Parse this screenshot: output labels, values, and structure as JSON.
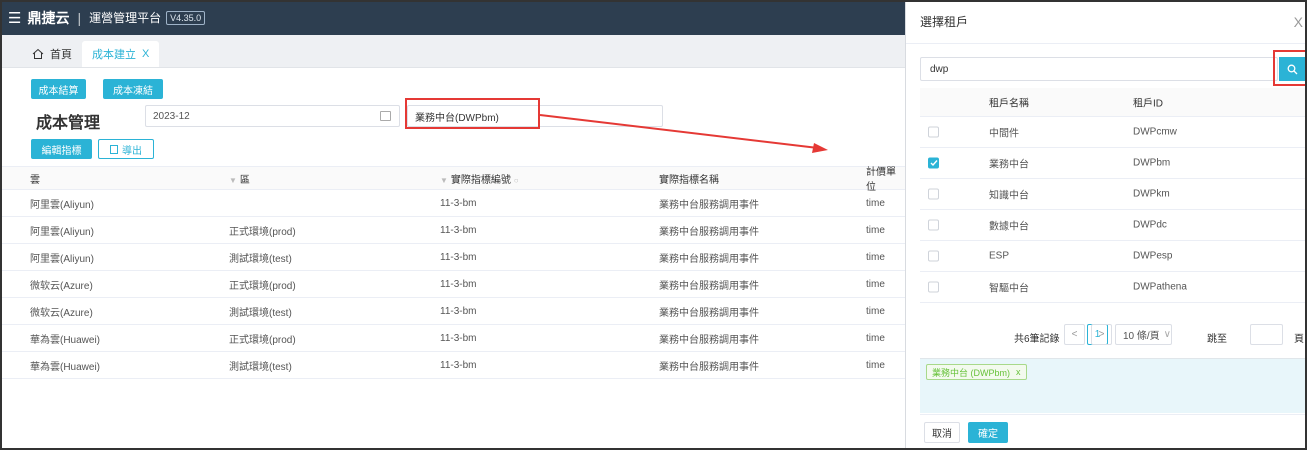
{
  "topbar": {
    "menu_glyph": "☰",
    "brand": "鼎捷云",
    "separator": "|",
    "platform": "運營管理平台",
    "version": "V4.35.0"
  },
  "tabs": [
    {
      "label": "首頁"
    },
    {
      "label": "成本建立",
      "close": "X"
    }
  ],
  "toolbar": {
    "settle_label": "成本結算",
    "freeze_label": "成本凍結",
    "edit_metric_label": "編輯指標",
    "export_label": "導出"
  },
  "page": {
    "title": "成本管理",
    "date_value": "2023-12",
    "tenant_value": "業務中台(DWPbm)"
  },
  "table": {
    "headers": [
      "雲",
      "區",
      "實際指標編號",
      "實際指標名稱",
      "計價單位"
    ],
    "rows": [
      [
        "阿里雲(Aliyun)",
        "",
        "11-3-bm",
        "業務中台服務調用事件",
        "time"
      ],
      [
        "阿里雲(Aliyun)",
        "正式環境(prod)",
        "11-3-bm",
        "業務中台服務調用事件",
        "time"
      ],
      [
        "阿里雲(Aliyun)",
        "測試環境(test)",
        "11-3-bm",
        "業務中台服務調用事件",
        "time"
      ],
      [
        "微软云(Azure)",
        "正式環境(prod)",
        "11-3-bm",
        "業務中台服務調用事件",
        "time"
      ],
      [
        "微软云(Azure)",
        "測試環境(test)",
        "11-3-bm",
        "業務中台服務調用事件",
        "time"
      ],
      [
        "華為雲(Huawei)",
        "正式環境(prod)",
        "11-3-bm",
        "業務中台服務調用事件",
        "time"
      ],
      [
        "華為雲(Huawei)",
        "測試環境(test)",
        "11-3-bm",
        "業務中台服務調用事件",
        "time"
      ]
    ]
  },
  "dialog": {
    "title": "選擇租戶",
    "close": "X",
    "search_value": "dwp",
    "headers": [
      "租戶名稱",
      "租戶ID"
    ],
    "rows": [
      {
        "name": "中間件",
        "id": "DWPcmw",
        "checked": false
      },
      {
        "name": "業務中台",
        "id": "DWPbm",
        "checked": true
      },
      {
        "name": "知識中台",
        "id": "DWPkm",
        "checked": false
      },
      {
        "name": "數據中台",
        "id": "DWPdc",
        "checked": false
      },
      {
        "name": "ESP",
        "id": "DWPesp",
        "checked": false
      },
      {
        "name": "智驅中台",
        "id": "DWPathena",
        "checked": false
      }
    ],
    "pager": {
      "total": "共6筆記錄",
      "prev": "<",
      "current": "1",
      "next": ">",
      "page_size": "10 條/頁",
      "jump_to": "跳至",
      "page_unit": "頁"
    },
    "selected_tag": "業務中台 (DWPbm)",
    "selected_tag_close": "x",
    "cancel_label": "取消",
    "ok_label": "確定"
  },
  "colors": {
    "accent": "#2bb3d6",
    "highlight": "#e53935",
    "topbar": "#2d3e50"
  }
}
